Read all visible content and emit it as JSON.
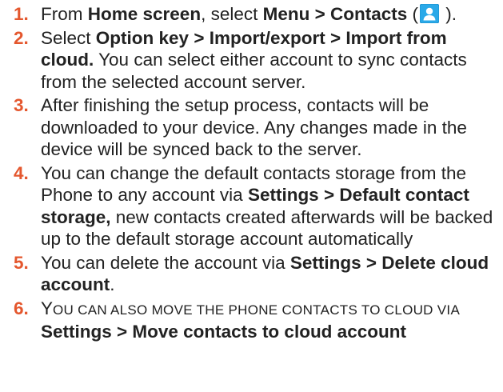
{
  "steps": [
    {
      "number": "1.",
      "segments": [
        {
          "text": "From ",
          "bold": false
        },
        {
          "text": "Home screen",
          "bold": true
        },
        {
          "text": ", select ",
          "bold": false
        },
        {
          "text": "Menu > Contacts",
          "bold": true
        },
        {
          "text": " (",
          "bold": false
        },
        {
          "icon": "contacts-app-icon"
        },
        {
          "text": " ).",
          "bold": false
        }
      ]
    },
    {
      "number": "2.",
      "segments": [
        {
          "text": "Select ",
          "bold": false
        },
        {
          "text": "Option key > Import/export > Import from cloud.",
          "bold": true
        },
        {
          "text": " You can select either account to sync contacts from the selected account server.",
          "bold": false
        }
      ]
    },
    {
      "number": "3.",
      "segments": [
        {
          "text": "After finishing the setup process, contacts will be downloaded to your device. Any changes made in the device will be synced back to the server.",
          "bold": false
        }
      ]
    },
    {
      "number": "4.",
      "segments": [
        {
          "text": "You can change the default contacts storage from the Phone to any account via ",
          "bold": false
        },
        {
          "text": "Settings > Default contact storage,",
          "bold": true
        },
        {
          "text": " new contacts created afterwards will be backed up to the default storage account automatically",
          "bold": false
        }
      ]
    },
    {
      "number": "5.",
      "segments": [
        {
          "text": "You can delete the account via ",
          "bold": false
        },
        {
          "text": "Settings > Delete cloud account",
          "bold": true
        },
        {
          "text": ".",
          "bold": false
        }
      ]
    },
    {
      "number": "6.",
      "segments": [
        {
          "text": "Y",
          "bold": false
        },
        {
          "text": "OU CAN ALSO MOVE THE PHONE CONTACTS TO CLOUD VIA ",
          "bold": false,
          "smallcaps": true
        },
        {
          "text": "Settings > Move contacts to cloud account",
          "bold": true
        }
      ]
    }
  ],
  "colors": {
    "number": "#e4572e",
    "text": "#222222",
    "icon_bg": "#2aa9e8"
  }
}
